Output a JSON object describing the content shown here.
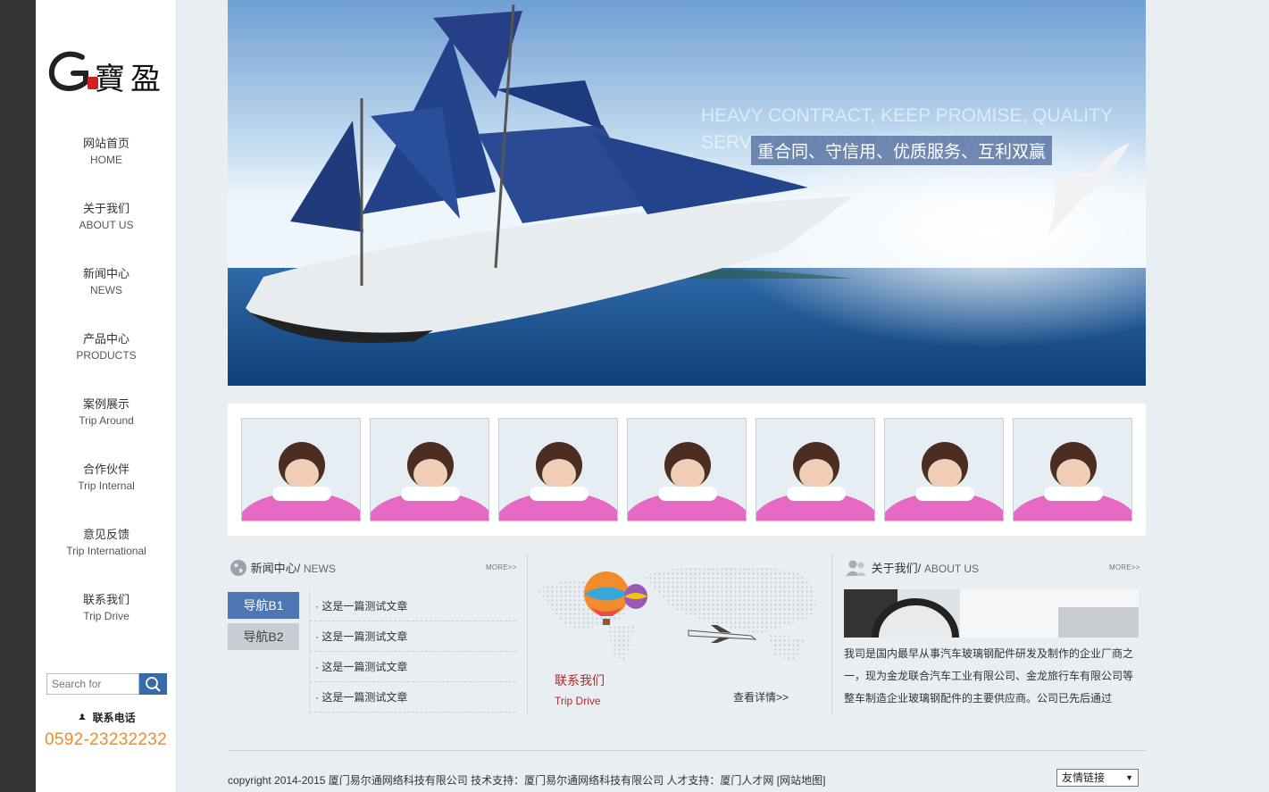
{
  "logo": {
    "text": "G寶盈"
  },
  "nav": [
    {
      "zh": "网站首页",
      "en": "HOME"
    },
    {
      "zh": "关于我们",
      "en": "ABOUT US"
    },
    {
      "zh": "新闻中心",
      "en": "NEWS"
    },
    {
      "zh": "产品中心",
      "en": "PRODUCTS"
    },
    {
      "zh": "案例展示",
      "en": "Trip Around"
    },
    {
      "zh": "合作伙伴",
      "en": "Trip Internal"
    },
    {
      "zh": "意见反馈",
      "en": "Trip International"
    },
    {
      "zh": "联系我们",
      "en": "Trip Drive"
    }
  ],
  "search": {
    "placeholder": "Search for"
  },
  "phone": {
    "label": "联系电话",
    "number": "0592-23232232"
  },
  "banner": {
    "en_line1": "HEAVY CONTRACT, KEEP PROMISE, QUALITY",
    "en_line2": "SERVICE, MUTUAL BENEFIT, WIN-WIN",
    "cn": "重合同、守信用、优质服务、互利双赢"
  },
  "gallery": {
    "count": 7
  },
  "news": {
    "title": "新闻中心/",
    "title_en": "NEWS",
    "more": "MORE>>",
    "tabs": [
      "导航B1",
      "导航B2"
    ],
    "items": [
      "这是一篇测试文章",
      "这是一篇测试文章",
      "这是一篇测试文章",
      "这是一篇测试文章"
    ]
  },
  "contact": {
    "title": "联系我们",
    "title_en": "Trip Drive",
    "more": "查看详情>>"
  },
  "about": {
    "title": "关于我们/",
    "title_en": "ABOUT US",
    "more": "MORE>>",
    "text": "我司是国内最早从事汽车玻璃钢配件研发及制作的企业厂商之一，现为金龙联合汽车工业有限公司、金龙旅行车有限公司等整车制造企业玻璃钢配件的主要供应商。公司已先后通过"
  },
  "footer": {
    "copyright": "copyright 2014-2015 厦门易尔通网络科技有限公司 技术支持：厦门易尔通网络科技有限公司 人才支持：厦门人才网 [网站地图]",
    "links_label": "友情链接",
    "arrow": "▼"
  },
  "colors": {
    "accent": "#4e76b2",
    "phone": "#ee8c27",
    "contact": "#b02a2a"
  }
}
